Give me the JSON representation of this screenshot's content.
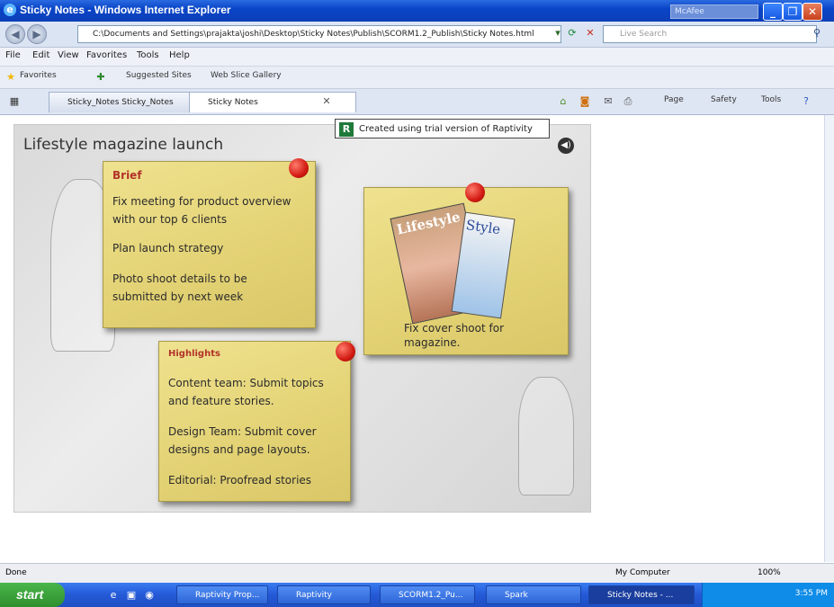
{
  "window": {
    "title": "Sticky Notes - Windows Internet Explorer",
    "mcafee": "McAfee"
  },
  "address": {
    "url": "C:\\Documents and Settings\\prajakta\\joshi\\Desktop\\Sticky Notes\\Publish\\SCORM1.2_Publish\\Sticky Notes.html",
    "search_placeholder": "Live Search"
  },
  "menu": [
    "File",
    "Edit",
    "View",
    "Favorites",
    "Tools",
    "Help"
  ],
  "favorites": {
    "label": "Favorites",
    "items": [
      "Suggested Sites",
      "Web Slice Gallery"
    ]
  },
  "tabs": [
    {
      "label": "Sticky_Notes Sticky_Notes"
    },
    {
      "label": "Sticky Notes"
    }
  ],
  "commands": [
    "Page",
    "Safety",
    "Tools"
  ],
  "trial_notice": "Created using trial version of Raptivity",
  "stage": {
    "title": "Lifestyle magazine launch",
    "notes": [
      {
        "heading": "Brief",
        "lines": [
          "Fix meeting for product overview",
          "with our top 6 clients",
          "Plan launch strategy",
          "Photo shoot details to be",
          "submitted by next week"
        ]
      },
      {
        "magazine": [
          "Lifestyle",
          "Style"
        ],
        "lines": [
          "Fix cover shoot for",
          "magazine."
        ]
      },
      {
        "heading": "Highlights",
        "lines": [
          "Content team: Submit topics",
          "and feature stories.",
          "Design Team: Submit cover",
          "designs and page layouts.",
          "Editorial: Proofread stories"
        ]
      }
    ]
  },
  "status": {
    "left": "Done",
    "zone": "My Computer",
    "zoom": "100%"
  },
  "taskbar": {
    "start": "start",
    "tasks": [
      "Raptivity Prop...",
      "Raptivity",
      "SCORM1.2_Pu...",
      "Spark",
      "Sticky Notes - ..."
    ],
    "clock": "3:55 PM"
  }
}
